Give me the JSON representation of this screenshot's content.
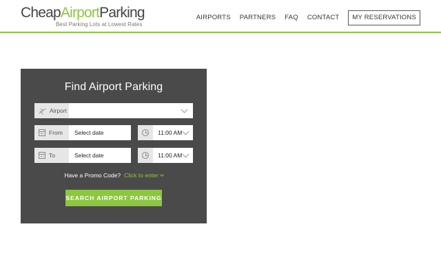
{
  "header": {
    "logo": {
      "cheap": "Cheap",
      "airport": "Airport",
      "parking": "Parking",
      "tagline": "Best Parking Lots at Lowest Rates"
    },
    "nav": [
      {
        "label": "AIRPORTS"
      },
      {
        "label": "PARTNERS"
      },
      {
        "label": "FAQ"
      },
      {
        "label": "CONTACT"
      }
    ],
    "reservations_label": "MY RESERVATIONS"
  },
  "search": {
    "title": "Find Airport Parking",
    "airport": {
      "label": "Airport",
      "value": ""
    },
    "from": {
      "label": "From",
      "date": "Select date",
      "time": "11:00 AM"
    },
    "to": {
      "label": "To",
      "date": "Select date",
      "time": "11:00 AM"
    },
    "promo_text": "Have a Promo Code?",
    "promo_link": "Click to enter",
    "button_label": "SEARCH AIRPORT PARKING"
  },
  "colors": {
    "accent": "#8dc63f",
    "panel": "#4a4a4a"
  }
}
